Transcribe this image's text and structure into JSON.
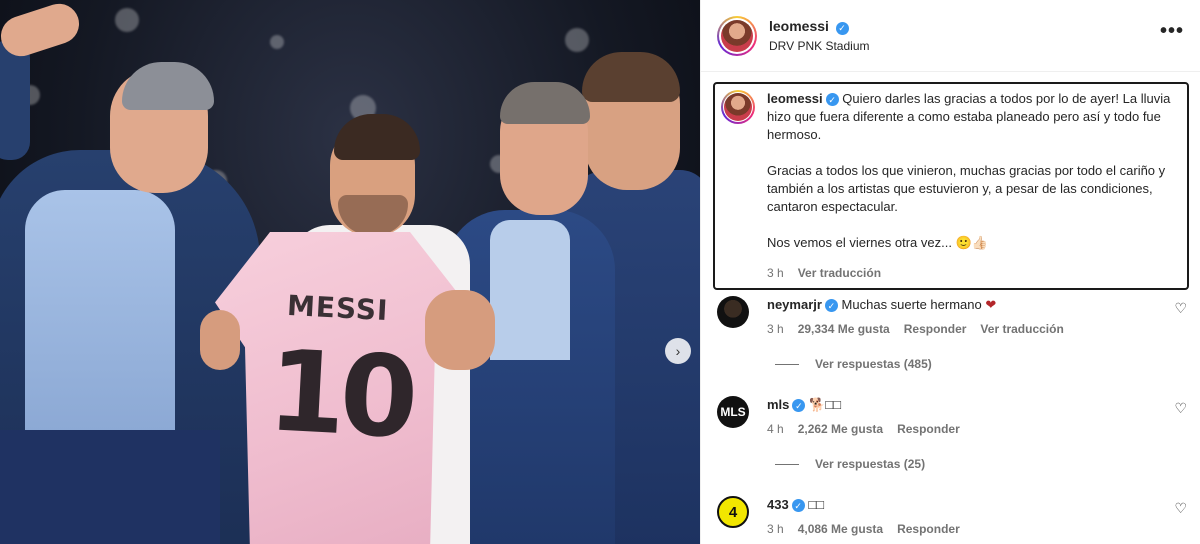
{
  "post": {
    "username": "leomessi",
    "location": "DRV PNK Stadium",
    "more_label": "•••"
  },
  "photo": {
    "jersey_name": "MESSI",
    "jersey_number": "10",
    "next_label": "›"
  },
  "caption": {
    "username": "leomessi",
    "paragraph1": "Quiero darles las gracias a todos por lo de ayer! La lluvia hizo que fuera diferente a como estaba planeado pero así y todo fue hermoso.",
    "paragraph2": "Gracias a todos los que vinieron, muchas gracias por todo el cariño y también a los artistas que estuvieron y, a pesar de las condiciones, cantaron espectacular.",
    "paragraph3": "Nos vemos el viernes otra vez... 🙂👍🏻",
    "time": "3 h",
    "translate": "Ver traducción"
  },
  "comments": [
    {
      "username": "neymarjr",
      "text": "Muchas suerte hermano",
      "emoji": "❤",
      "time": "3 h",
      "likes": "29,334 Me gusta",
      "reply": "Responder",
      "translate": "Ver traducción",
      "replies": "Ver respuestas (485)"
    },
    {
      "username": "mls",
      "text": "🐕□□",
      "avatar_label": "MLS",
      "time": "4 h",
      "likes": "2,262 Me gusta",
      "reply": "Responder",
      "replies": "Ver respuestas (25)"
    },
    {
      "username": "433",
      "text": "□□",
      "avatar_label": "4",
      "time": "3 h",
      "likes": "4,086 Me gusta",
      "reply": "Responder"
    }
  ],
  "icons": {
    "verified": "✓",
    "heart": "♡"
  }
}
